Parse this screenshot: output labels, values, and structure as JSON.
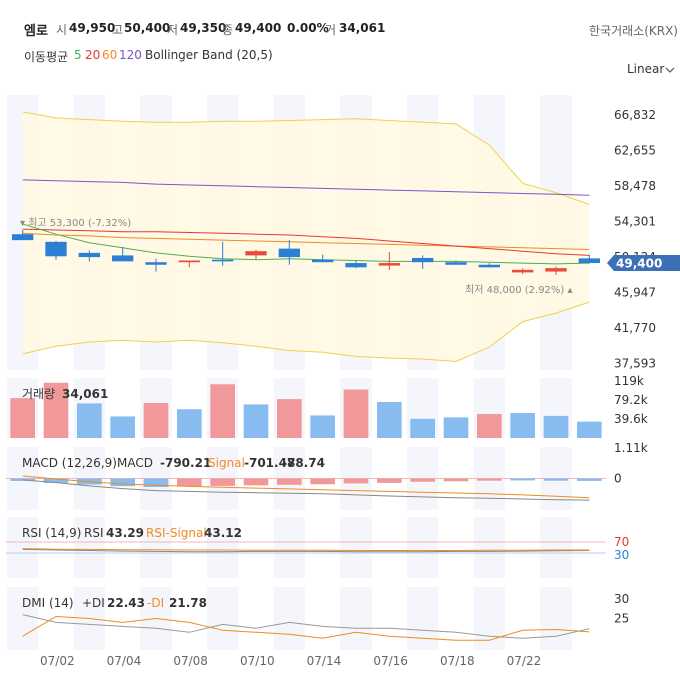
{
  "header": {
    "name": "엠로",
    "open_label": "시",
    "open": "49,950",
    "high_label": "고",
    "high": "50,400",
    "low_label": "저",
    "low": "49,350",
    "close_label": "종",
    "close": "49,400",
    "change": "0.00%",
    "volume_label": "거",
    "volume": "34,061",
    "exchange": "한국거래소(KRX)",
    "ma_label": "이동평균",
    "ma_periods": [
      "5",
      "20",
      "60",
      "120"
    ],
    "bb_label": "Bollinger Band (20,5)",
    "scale": "Linear"
  },
  "colors": {
    "up": "#e74c3c",
    "down": "#2b7fd4",
    "up_vol": "#f1999a",
    "down_vol": "#88bbef",
    "ma5": "#4caf50",
    "ma20": "#e53935",
    "ma60": "#f08c1e",
    "ma120": "#7e57c2",
    "bb": "#f0d050",
    "bb_fill": "#fff8e1",
    "price_tag": "#3d6fb6"
  },
  "chart_data": [
    {
      "type": "candlestick",
      "title": "",
      "x": [
        "07/01",
        "07/02",
        "07/03",
        "07/04",
        "07/05",
        "07/08",
        "07/09",
        "07/10",
        "07/11",
        "07/12",
        "07/15",
        "07/16",
        "07/17",
        "07/18",
        "07/19",
        "07/22",
        "07/23",
        "07/24"
      ],
      "x_tick_labels": [
        "07/02",
        "07/04",
        "07/08",
        "07/10",
        "07/14",
        "07/16",
        "07/18",
        "07/22"
      ],
      "y_tick_labels": [
        "66,832",
        "62,655",
        "58,478",
        "54,301",
        "50,124",
        "45,947",
        "41,770",
        "37,593"
      ],
      "ylim": [
        36800,
        69200
      ],
      "open": [
        52800,
        51900,
        50600,
        50300,
        49500,
        49500,
        49800,
        50300,
        51100,
        49800,
        49400,
        49100,
        50000,
        49500,
        49200,
        48300,
        48400,
        49950
      ],
      "high": [
        53300,
        52000,
        50900,
        51300,
        49900,
        49700,
        51900,
        51000,
        52100,
        50400,
        49700,
        50700,
        50300,
        49700,
        49400,
        48800,
        49000,
        50400
      ],
      "low": [
        52100,
        49800,
        49600,
        49600,
        48400,
        48900,
        49100,
        49800,
        49200,
        49500,
        48800,
        48600,
        48700,
        49200,
        48900,
        48100,
        48000,
        49350
      ],
      "close": [
        52100,
        50200,
        50100,
        49600,
        49200,
        49700,
        49600,
        50800,
        50100,
        49500,
        48900,
        49400,
        49500,
        49200,
        48900,
        48600,
        48800,
        49400
      ],
      "price_tag": "49,400",
      "annotations": {
        "high": "최고 53,300 (-7.32%)",
        "low": "최저 48,000 (2.92%)"
      },
      "series": [
        {
          "name": "5",
          "values": [
            54000,
            52800,
            51800,
            51200,
            50600,
            50200,
            49900,
            49800,
            49900,
            49800,
            49700,
            49600,
            49600,
            49600,
            49500,
            49400,
            49300,
            49400
          ]
        },
        {
          "name": "20",
          "values": [
            53400,
            53300,
            53200,
            53100,
            53100,
            53000,
            52900,
            52800,
            52700,
            52500,
            52300,
            52000,
            51700,
            51400,
            51100,
            50800,
            50500,
            50300
          ]
        },
        {
          "name": "60",
          "values": [
            52900,
            52700,
            52600,
            52400,
            52300,
            52200,
            52100,
            52000,
            51900,
            51800,
            51700,
            51600,
            51500,
            51400,
            51300,
            51200,
            51100,
            51000
          ]
        },
        {
          "name": "120",
          "values": [
            59200,
            59100,
            59000,
            58900,
            58700,
            58600,
            58500,
            58400,
            58300,
            58200,
            58100,
            58000,
            57900,
            57800,
            57700,
            57600,
            57500,
            57400
          ]
        },
        {
          "name": "BB upper",
          "values": [
            67200,
            66500,
            66300,
            66100,
            66000,
            66000,
            66100,
            66100,
            66200,
            66300,
            66400,
            66200,
            66000,
            65800,
            63300,
            58800,
            57700,
            56300
          ]
        },
        {
          "name": "BB lower",
          "values": [
            38700,
            39600,
            40100,
            40300,
            40100,
            40300,
            40000,
            39600,
            39100,
            38900,
            38400,
            38200,
            38100,
            37800,
            39500,
            42500,
            43500,
            44800
          ]
        }
      ]
    },
    {
      "type": "bar",
      "title": "거래량",
      "value_label": "34,061",
      "y_tick_labels": [
        "119k",
        "79.2k",
        "39.6k"
      ],
      "ylim": [
        0,
        125000
      ],
      "values": [
        83000,
        115000,
        72000,
        45000,
        73000,
        60000,
        112000,
        70000,
        81000,
        47000,
        101000,
        75000,
        40000,
        43000,
        50000,
        52000,
        46000,
        34061
      ],
      "direction": [
        "up",
        "up",
        "down",
        "down",
        "up",
        "down",
        "up",
        "down",
        "up",
        "down",
        "up",
        "down",
        "down",
        "down",
        "up",
        "down",
        "down",
        "down"
      ]
    },
    {
      "type": "line",
      "title": "MACD (12,26,9)",
      "macd_label": "MACD",
      "macd_value": "-790.21",
      "signal_label": "Signal",
      "signal_value": "-701.47",
      "hist_value": "-88.74",
      "y_tick_labels": [
        "1.11k",
        "0"
      ],
      "ylim": [
        -1150,
        1150
      ],
      "series": [
        {
          "name": "MACD",
          "values": [
            -50,
            -150,
            -270,
            -370,
            -440,
            -470,
            -500,
            -520,
            -540,
            -560,
            -600,
            -640,
            -670,
            -700,
            -720,
            -750,
            -775,
            -790
          ]
        },
        {
          "name": "Signal",
          "values": [
            90,
            -20,
            -120,
            -200,
            -250,
            -290,
            -320,
            -350,
            -380,
            -410,
            -440,
            -470,
            -500,
            -530,
            -560,
            -600,
            -650,
            -701
          ]
        },
        {
          "name": "hist",
          "values": [
            -90,
            -160,
            -220,
            -280,
            -310,
            -290,
            -270,
            -250,
            -230,
            -210,
            -180,
            -160,
            -120,
            -100,
            -80,
            -70,
            -80,
            -89
          ]
        }
      ]
    },
    {
      "type": "line",
      "title": "RSI (14,9)",
      "rsi_label": "RSI",
      "rsi_value": "43.29",
      "signal_label": "RSI-Signal",
      "signal_value": "43.12",
      "y_tick_labels": [
        "70",
        "30"
      ],
      "ylim": [
        -60,
        160
      ],
      "series": [
        {
          "name": "RSI",
          "values": [
            43,
            41,
            39,
            37,
            36,
            35,
            35,
            36,
            36,
            36,
            35,
            35,
            35,
            36,
            36,
            37,
            38,
            39
          ]
        },
        {
          "name": "RSI-Signal",
          "values": [
            46,
            44,
            43,
            42,
            42,
            41,
            41,
            40,
            40,
            40,
            39,
            39,
            39,
            39,
            40,
            40,
            41,
            41
          ]
        }
      ]
    },
    {
      "type": "line",
      "title": "DMI (14)",
      "pdi_label": "+DI",
      "pdi_value": "22.43",
      "mdi_label": "-DI",
      "mdi_value": "21.78",
      "y_tick_labels": [
        "30",
        "25"
      ],
      "ylim": [
        17,
        33
      ],
      "series": [
        {
          "name": "+DI",
          "values": [
            20.5,
            25.5,
            25.0,
            24.0,
            25.0,
            24.0,
            22.0,
            21.5,
            21.0,
            20.0,
            21.5,
            20.5,
            20.0,
            19.5,
            19.5,
            22.0,
            22.2,
            21.6
          ]
        },
        {
          "name": "-DI",
          "values": [
            26.0,
            24.0,
            23.5,
            23.0,
            22.5,
            21.5,
            23.5,
            22.5,
            24.0,
            23.0,
            22.5,
            22.5,
            22.0,
            21.5,
            20.5,
            20.0,
            20.5,
            22.4
          ]
        }
      ]
    }
  ]
}
